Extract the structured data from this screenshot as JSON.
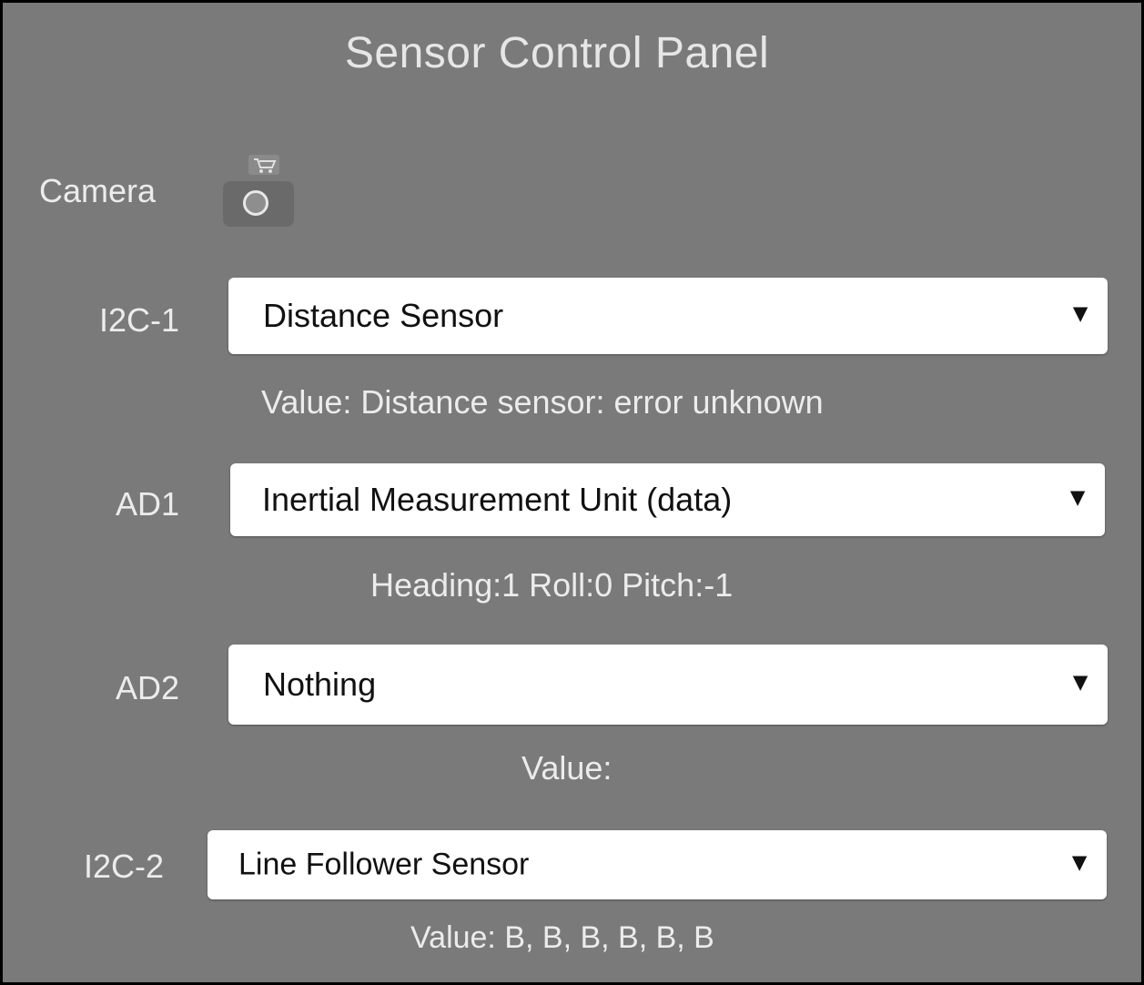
{
  "panel": {
    "title": "Sensor Control Panel"
  },
  "camera": {
    "label": "Camera",
    "icon": "camera-icon"
  },
  "ports": [
    {
      "label": "I2C-1",
      "selected": "Distance Sensor",
      "value": "Value: Distance sensor: error unknown"
    },
    {
      "label": "AD1",
      "selected": "Inertial Measurement Unit (data)",
      "value": "Heading:1 Roll:0 Pitch:-1"
    },
    {
      "label": "AD2",
      "selected": "Nothing",
      "value": "Value:"
    },
    {
      "label": "I2C-2",
      "selected": "Line Follower Sensor",
      "value": "Value: B, B, B, B, B, B"
    }
  ],
  "icons": {
    "dropdown": "chevron-down-icon"
  },
  "colors": {
    "panel_bg": "#7a7a7a",
    "text_light": "#ececec",
    "select_bg": "#ffffff"
  }
}
